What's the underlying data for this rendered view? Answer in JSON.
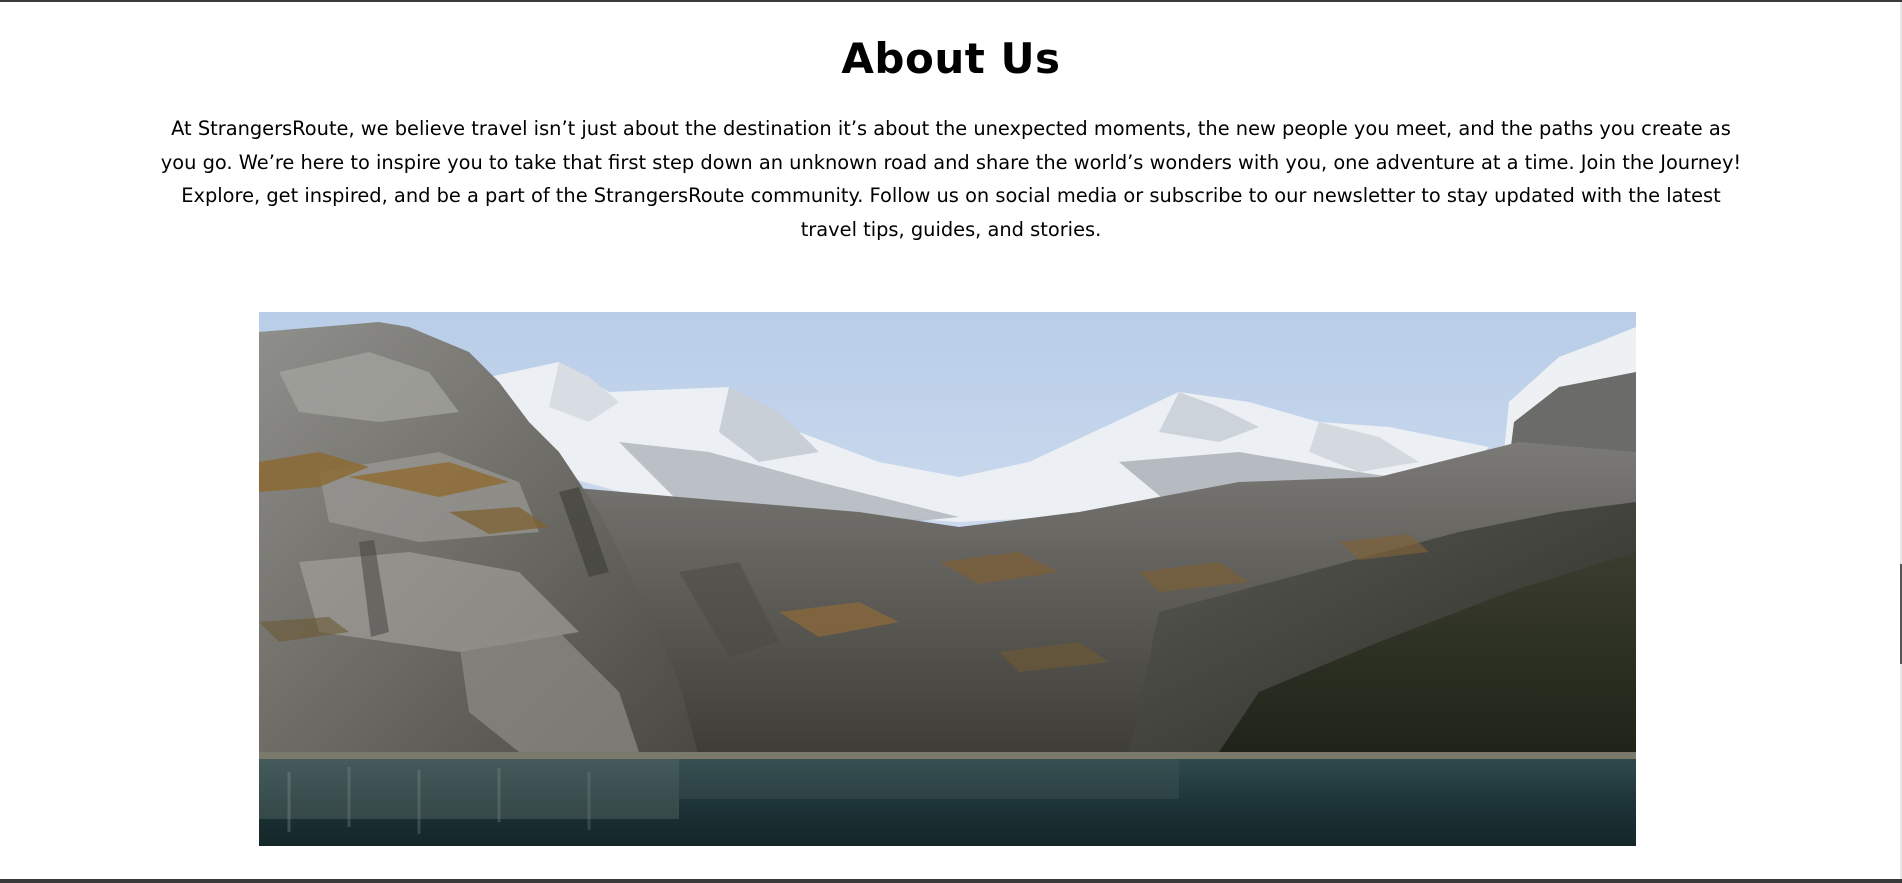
{
  "section": {
    "title": "About Us",
    "paragraph": "At StrangersRoute, we believe travel isn’t just about the destination it’s about the unexpected moments, the new people you meet, and the paths you create as you go. We’re here to inspire you to take that first step down an unknown road and share the world’s wonders with you, one adventure at a time. Join the Journey! Explore, get inspired, and be a part of the StrangersRoute community. Follow us on social media or subscribe to our newsletter to stay updated with the latest travel tips, guides, and stories."
  },
  "image": {
    "subject": "alpine-lake-mountains-photo"
  }
}
